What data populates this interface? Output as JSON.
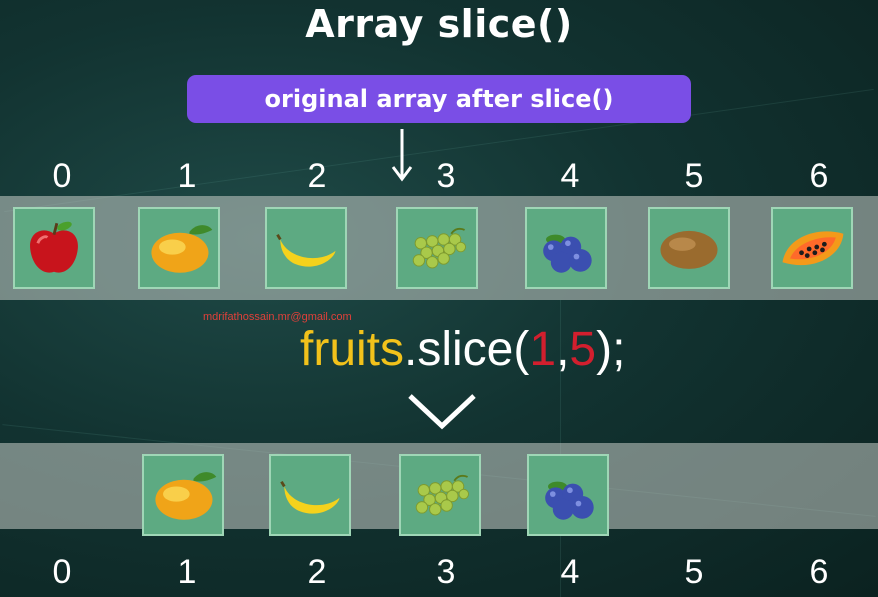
{
  "title": "Array slice()",
  "banner": "original array after slice()",
  "indices_top": [
    "0",
    "1",
    "2",
    "3",
    "4",
    "5",
    "6"
  ],
  "indices_bottom": [
    "0",
    "1",
    "2",
    "3",
    "4",
    "5",
    "6"
  ],
  "original_array": [
    "apple-icon",
    "mango-icon",
    "banana-icon",
    "grapes-icon",
    "blueberries-icon",
    "kiwi-icon",
    "papaya-icon"
  ],
  "sliced_array": [
    "mango-icon",
    "banana-icon",
    "grapes-icon",
    "blueberries-icon"
  ],
  "watermark": "mdrifathossain.mr@gmail.com",
  "code": {
    "object": "fruits",
    "method": ".slice(",
    "arg1": "1",
    "sep": ",",
    "arg2": "5",
    "close": ");"
  },
  "colors": {
    "banner": "#7a4ee6",
    "cell": "#5daa82",
    "object": "#f2c21b",
    "number": "#d21f2e"
  }
}
